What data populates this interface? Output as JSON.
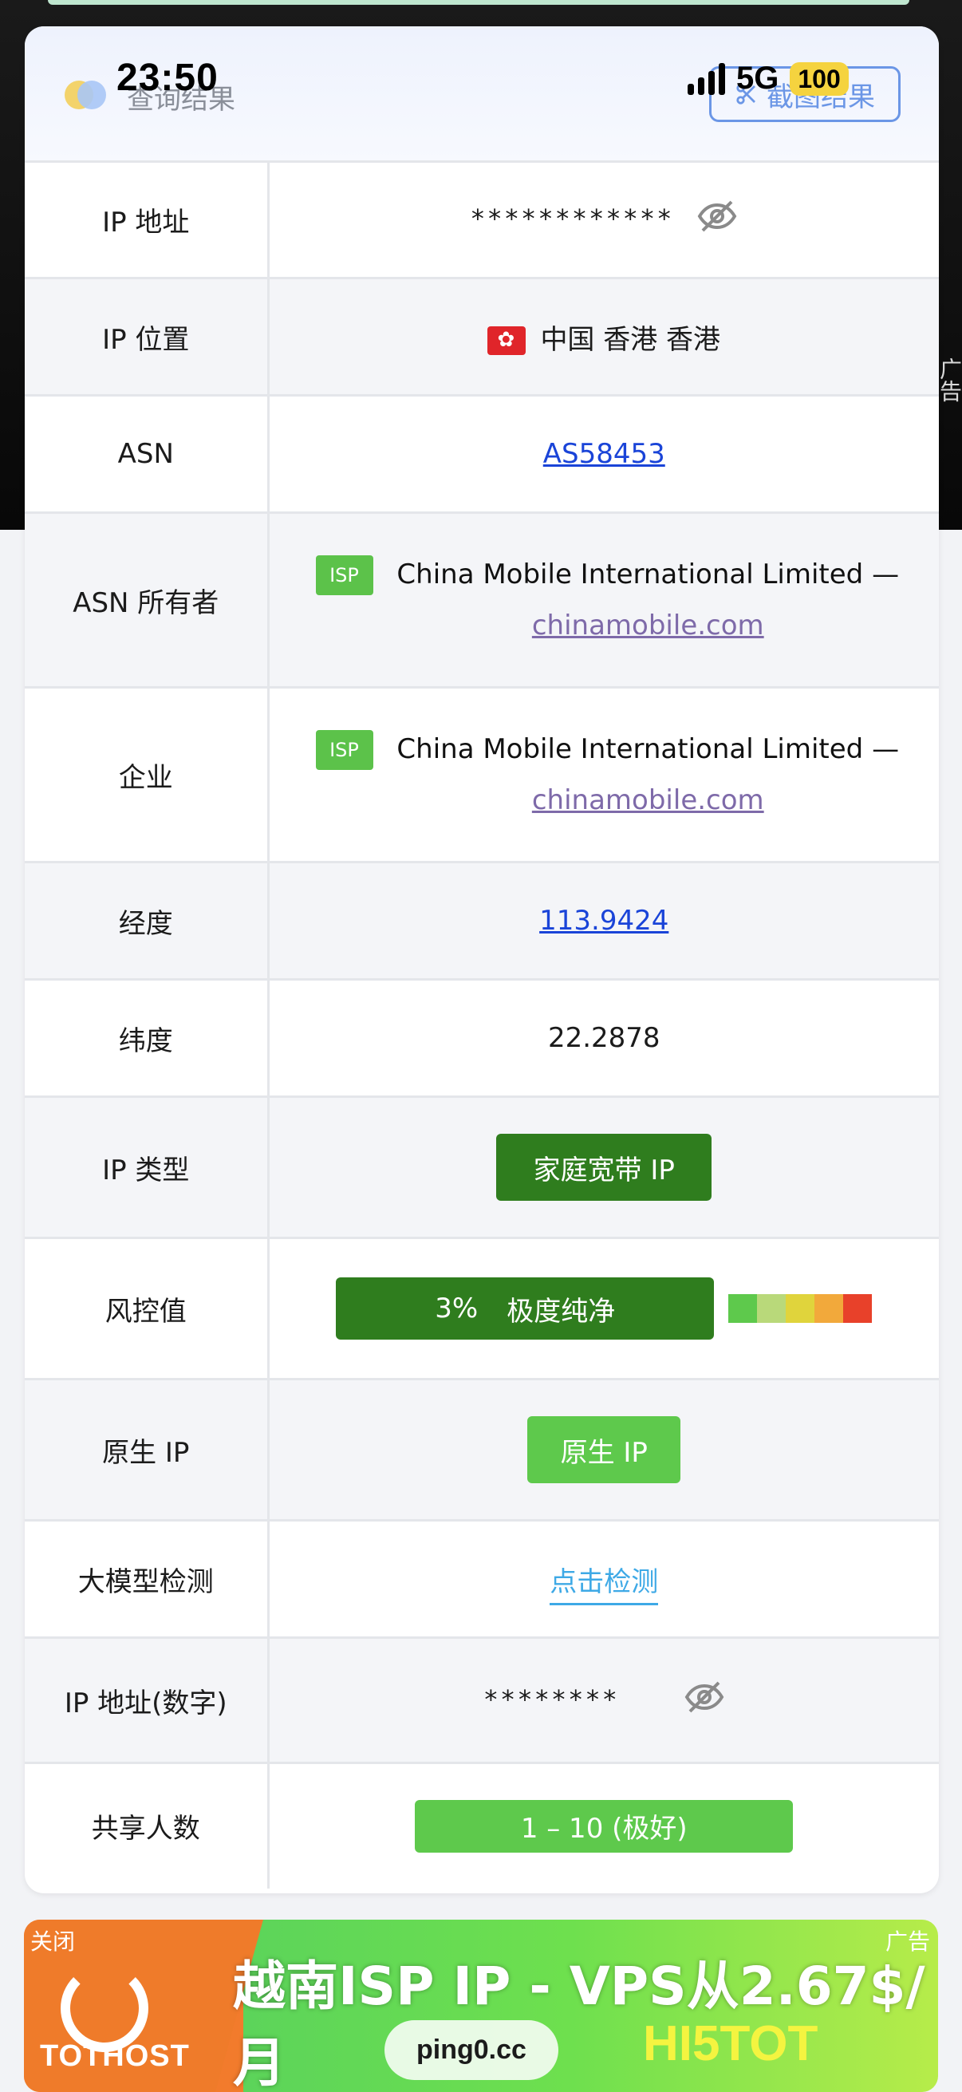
{
  "status_bar": {
    "time": "23:50",
    "network": "5G",
    "battery": "100"
  },
  "side_ad": "广告",
  "card": {
    "title": "查询结果",
    "screenshot_button": "截图结果"
  },
  "rows": {
    "ip_address": {
      "label": "IP 地址",
      "value": "************"
    },
    "ip_location": {
      "label": "IP 位置",
      "value": "中国 香港 香港"
    },
    "asn": {
      "label": "ASN",
      "value": "AS58453"
    },
    "asn_owner": {
      "label": "ASN 所有者",
      "tag": "ISP",
      "name": "China Mobile International Limited —",
      "domain": "chinamobile.com"
    },
    "enterprise": {
      "label": "企业",
      "tag": "ISP",
      "name": "China Mobile International Limited —",
      "domain": "chinamobile.com"
    },
    "longitude": {
      "label": "经度",
      "value": "113.9424"
    },
    "latitude": {
      "label": "纬度",
      "value": "22.2878"
    },
    "ip_type": {
      "label": "IP 类型",
      "value": "家庭宽带 IP"
    },
    "risk": {
      "label": "风控值",
      "percent": "3%",
      "text": "极度纯净"
    },
    "native_ip": {
      "label": "原生 IP",
      "value": "原生 IP"
    },
    "llm_detect": {
      "label": "大模型检测",
      "value": "点击检测"
    },
    "ip_numeric": {
      "label": "IP 地址(数字)",
      "value": "********"
    },
    "shared_users": {
      "label": "共享人数",
      "value": "1 – 10 (极好)"
    }
  },
  "banner": {
    "close": "关闭",
    "ad": "广告",
    "logo": "TOTHOST",
    "headline": "越南ISP IP - VPS从2.67$/月",
    "site": "ping0.cc",
    "code": "HI5TOT"
  },
  "colors": {
    "dark_green": "#2f7d1e",
    "green": "#5ec94c",
    "link_blue": "#1a44d8",
    "risk_scale": [
      "#5ec94c",
      "#b9d97a",
      "#e0d43c",
      "#f2a93b",
      "#e8412a"
    ]
  }
}
